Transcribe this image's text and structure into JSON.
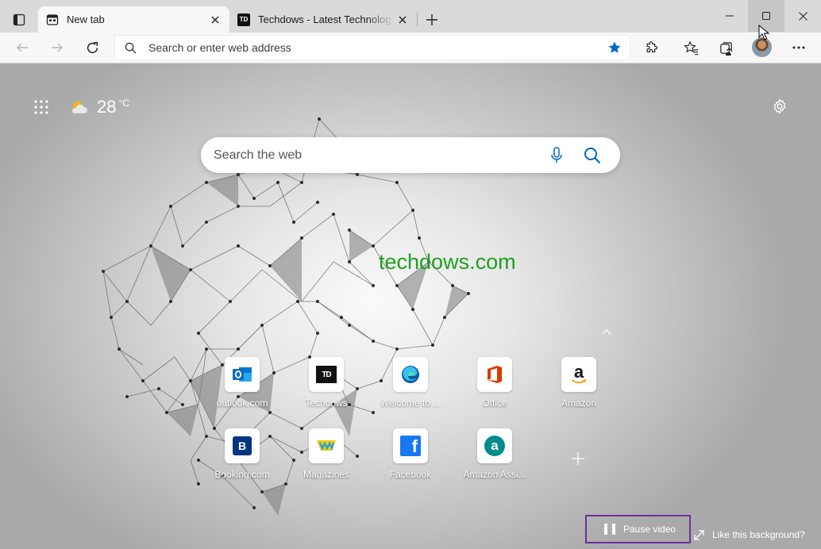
{
  "tabs": [
    {
      "title": "New tab",
      "favicon": "newtab-page-icon",
      "active": true
    },
    {
      "title": "Techdows - Latest Technology News",
      "favicon": "techdows-favicon",
      "favicon_text": "TD",
      "active": false
    }
  ],
  "toolbar": {
    "address_placeholder": "Search or enter web address"
  },
  "ntp": {
    "weather": {
      "temperature": "28",
      "unit": "°C",
      "icon": "partly-sunny-icon"
    },
    "search_placeholder": "Search the web",
    "watermark": "techdows.com",
    "quick_links": [
      {
        "label": "outlook.com",
        "icon": "outlook-icon"
      },
      {
        "label": "Techdows",
        "icon": "techdows-icon",
        "icon_text": "TD"
      },
      {
        "label": "Welcome to ...",
        "icon": "edge-icon"
      },
      {
        "label": "Office",
        "icon": "office-icon"
      },
      {
        "label": "Amazon",
        "icon": "amazon-icon",
        "icon_text": "a"
      },
      {
        "label": "Booking.com",
        "icon": "booking-icon",
        "icon_text": "B"
      },
      {
        "label": "Magazines",
        "icon": "magazines-icon"
      },
      {
        "label": "Facebook",
        "icon": "facebook-icon",
        "icon_text": "f"
      },
      {
        "label": "Amazon Assi...",
        "icon": "amazon-assistant-icon",
        "icon_text": "a"
      }
    ],
    "pause_label": "Pause video",
    "like_label": "Like this background?"
  },
  "colors": {
    "accent_blue": "#0067c0",
    "watermark_green": "#1fa01f",
    "highlight_purple": "#6b2fa0",
    "outlook_blue": "#0f6cbd",
    "office_red": "#d83b01",
    "facebook_blue": "#1877f2",
    "booking_navy": "#003580",
    "amazon_assistant_teal": "#008c8c"
  }
}
